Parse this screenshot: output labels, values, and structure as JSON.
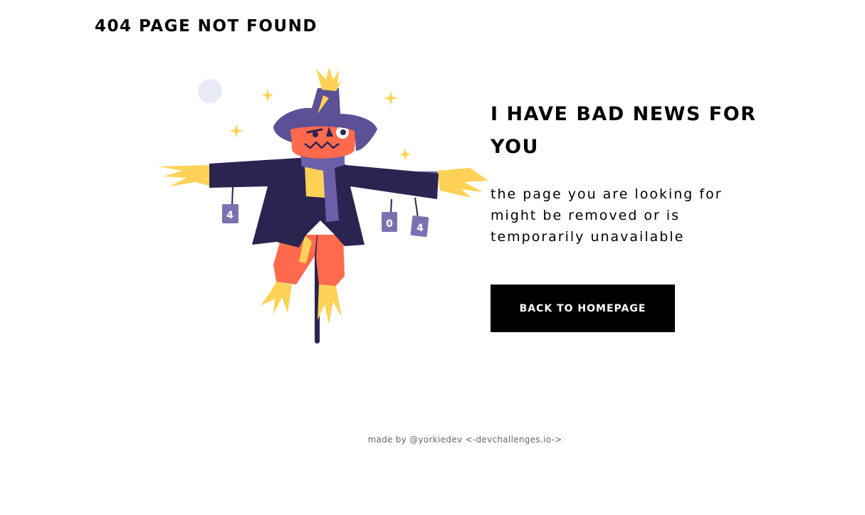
{
  "header": {
    "title": "404 PAGE NOT FOUND"
  },
  "illustration": {
    "cans": [
      "4",
      "0",
      "4"
    ],
    "colors": {
      "hat": "#5c5096",
      "coat": "#2b2350",
      "face": "#ff6a4d",
      "straw": "#ffd257",
      "scarf": "#6c5fa8",
      "can": "#7b71b0",
      "moon": "#e8ebf5"
    }
  },
  "main": {
    "headline": "I HAVE BAD NEWS FOR YOU",
    "description": "the page you are looking for might be removed or is temporarily unavailable",
    "button_label": "BACK TO HOMEPAGE"
  },
  "footer": {
    "credit": "made by @yorkiedev <-devchallenges.io->"
  }
}
